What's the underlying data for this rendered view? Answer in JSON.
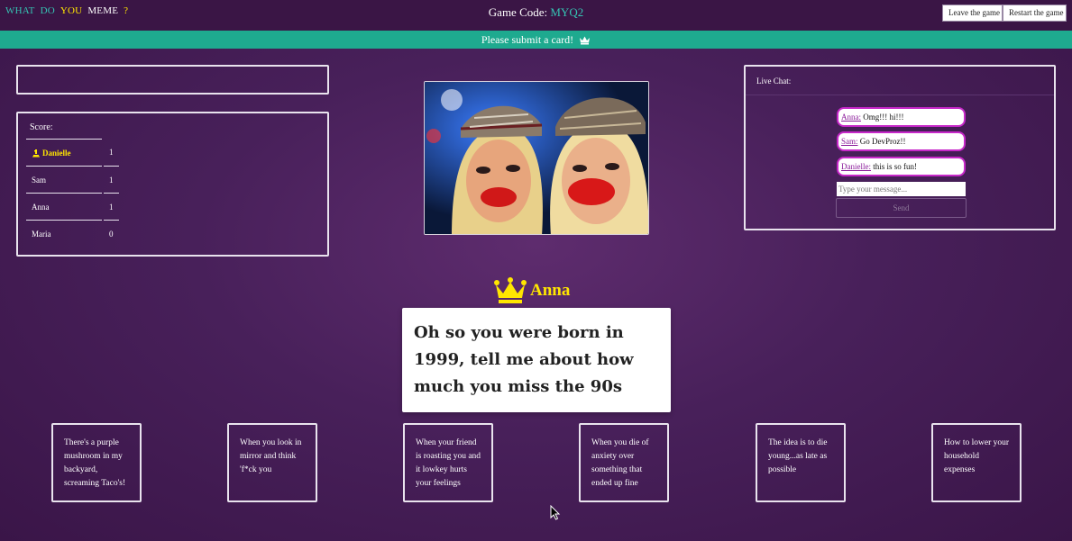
{
  "logo": {
    "words": [
      {
        "text": "WHAT",
        "color": "#35c4b3"
      },
      {
        "text": "DO",
        "color": "#35c4b3"
      },
      {
        "text": "YOU",
        "color": "#ffe600"
      },
      {
        "text": "MEME",
        "color": "#ffffff"
      },
      {
        "text": "?",
        "color": "#ffe600"
      }
    ]
  },
  "header": {
    "game_code_label": "Game Code:",
    "game_code": "MYQ2",
    "leave_label": "Leave the game",
    "restart_label": "Restart the game"
  },
  "banner": {
    "text": "Please submit a card!",
    "icon": "crown-icon"
  },
  "scoreboard": {
    "title": "Score:",
    "rows": [
      {
        "name": "Danielle",
        "points": "1",
        "leader": true
      },
      {
        "name": "Sam",
        "points": "1",
        "leader": false
      },
      {
        "name": "Anna",
        "points": "1",
        "leader": false
      },
      {
        "name": "Maria",
        "points": "0",
        "leader": false
      }
    ]
  },
  "chat": {
    "title": "Live Chat:",
    "messages": [
      {
        "user": "Anna:",
        "text": "Omg!!! hi!!!"
      },
      {
        "user": "Sam:",
        "text": "Go DevProz!!"
      },
      {
        "user": "Danielle:",
        "text": "this is so fun!"
      }
    ],
    "input_placeholder": "Type your message...",
    "send_label": "Send"
  },
  "judge": {
    "name": "Anna",
    "icon": "crown-icon"
  },
  "prompt": {
    "text": "Oh so you were born in 1999, tell me about how much you miss the 90s"
  },
  "hand": [
    "There's a purple mushroom in my backyard, screaming Taco's!",
    "When you look in mirror and think 'f*ck you",
    "When your friend is roasting you and it lowkey hurts your feelings",
    "When you die of anxiety over something that ended up fine",
    "The idea is to die young...as late as possible",
    "How to lower your household expenses"
  ],
  "colors": {
    "accent_teal": "#35c4b3",
    "banner_green": "#1eaa8f",
    "crown_yellow": "#ffe600",
    "chat_border": "#c728c9"
  }
}
